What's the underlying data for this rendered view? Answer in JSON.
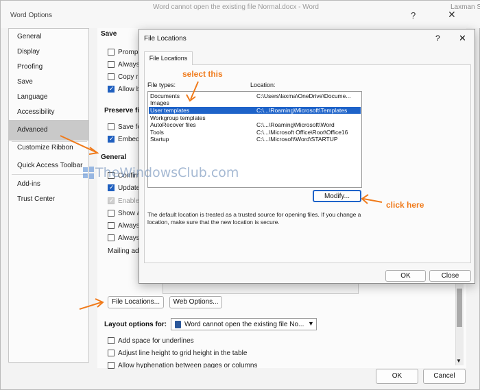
{
  "window": {
    "title": "Word Options",
    "background_title": "Word cannot open the existing file Normal.docx  -  Word",
    "user": "Laxman Si",
    "help_icon": "?",
    "close_icon": "✕"
  },
  "nav": {
    "items": [
      {
        "label": "General"
      },
      {
        "label": "Display"
      },
      {
        "label": "Proofing"
      },
      {
        "label": "Save"
      },
      {
        "label": "Language"
      },
      {
        "label": "Accessibility"
      },
      {
        "label": "Advanced",
        "selected": true
      },
      {
        "label": "Customize Ribbon"
      },
      {
        "label": "Quick Access Toolbar"
      },
      {
        "label": "Add-ins"
      },
      {
        "label": "Trust Center"
      }
    ]
  },
  "main": {
    "save_heading": "Save",
    "save_options": [
      {
        "label": "Promp",
        "checked": false
      },
      {
        "label": "Always",
        "checked": false
      },
      {
        "label": "Copy r",
        "checked": false
      },
      {
        "label": "Allow b",
        "checked": true
      }
    ],
    "preserve_heading": "Preserve fi",
    "preserve_options": [
      {
        "label": "Save fo",
        "checked": false
      },
      {
        "label": "Embed",
        "checked": true
      }
    ],
    "general_heading": "General",
    "general_options": [
      {
        "label": "Confirm",
        "checked": false,
        "disabled": false
      },
      {
        "label": "Update",
        "checked": true,
        "disabled": false
      },
      {
        "label": "Enable",
        "checked": true,
        "disabled": true
      },
      {
        "label": "Show a",
        "checked": false,
        "disabled": false
      },
      {
        "label": "Always",
        "checked": false,
        "disabled": false
      },
      {
        "label": "Always",
        "checked": false,
        "disabled": false
      }
    ],
    "mailing_label": "Mailing ad",
    "file_locations_button": "File Locations...",
    "web_options_button": "Web Options...",
    "layout_label": "Layout options for:",
    "layout_doc": "Word cannot open the existing file No...",
    "layout_options": [
      {
        "label": "Add space for underlines",
        "checked": false
      },
      {
        "label": "Adjust line height to grid height in the table",
        "checked": false
      },
      {
        "label": "Allow hyphenation between pages or columns",
        "checked": false
      }
    ],
    "ok_button": "OK",
    "cancel_button": "Cancel"
  },
  "file_locations": {
    "title": "File Locations",
    "help_icon": "?",
    "close_icon": "✕",
    "tab": "File Locations",
    "file_types_header": "File types:",
    "location_header": "Location:",
    "rows": [
      {
        "type": "Documents",
        "location": "C:\\Users\\laxma\\OneDrive\\Docume...",
        "selected": false
      },
      {
        "type": "Images",
        "location": "",
        "selected": false
      },
      {
        "type": "User templates",
        "location": "C:\\...\\Roaming\\Microsoft\\Templates",
        "selected": true
      },
      {
        "type": "Workgroup templates",
        "location": "",
        "selected": false
      },
      {
        "type": "AutoRecover files",
        "location": "C:\\...\\Roaming\\Microsoft\\Word",
        "selected": false
      },
      {
        "type": "Tools",
        "location": "C:\\...\\Microsoft Office\\Root\\Office16",
        "selected": false
      },
      {
        "type": "Startup",
        "location": "C:\\...\\Microsoft\\Word\\STARTUP",
        "selected": false
      }
    ],
    "modify_button": "Modify...",
    "description": "The default location is treated as a trusted source for opening files. If you change a location, make sure that the new location is secure.",
    "ok_button": "OK",
    "close_button": "Close"
  },
  "annotations": {
    "select_label": "select this",
    "click_label": "click here",
    "color": "#f07a1a"
  },
  "watermark": "TheWindowsClub.com"
}
